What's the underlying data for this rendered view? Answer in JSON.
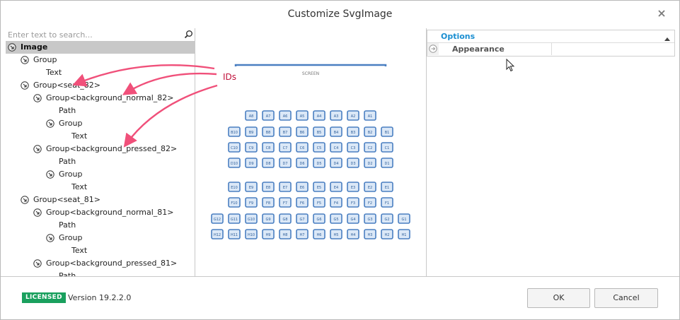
{
  "window": {
    "title": "Customize SvgImage",
    "close_icon": "close-icon"
  },
  "search": {
    "placeholder": "Enter text to search..."
  },
  "tree": {
    "nodes": [
      {
        "label": "Image",
        "level": 0,
        "icon": "collapse-arrow-icon",
        "selected": true
      },
      {
        "label": "Group",
        "level": 1,
        "icon": "collapse-arrow-icon"
      },
      {
        "label": "Text",
        "level": 2,
        "icon": ""
      },
      {
        "label": "Group<seat_82>",
        "level": 1,
        "icon": "collapse-arrow-icon"
      },
      {
        "label": "Group<background_normal_82>",
        "level": 2,
        "icon": "collapse-arrow-icon"
      },
      {
        "label": "Path",
        "level": 3,
        "icon": ""
      },
      {
        "label": "Group",
        "level": 3,
        "icon": "collapse-arrow-icon"
      },
      {
        "label": "Text",
        "level": 4,
        "icon": ""
      },
      {
        "label": "Group<background_pressed_82>",
        "level": 2,
        "icon": "collapse-arrow-icon"
      },
      {
        "label": "Path",
        "level": 3,
        "icon": ""
      },
      {
        "label": "Group",
        "level": 3,
        "icon": "collapse-arrow-icon"
      },
      {
        "label": "Text",
        "level": 4,
        "icon": ""
      },
      {
        "label": "Group<seat_81>",
        "level": 1,
        "icon": "collapse-arrow-icon"
      },
      {
        "label": "Group<background_normal_81>",
        "level": 2,
        "icon": "collapse-arrow-icon"
      },
      {
        "label": "Path",
        "level": 3,
        "icon": ""
      },
      {
        "label": "Group",
        "level": 3,
        "icon": "collapse-arrow-icon"
      },
      {
        "label": "Text",
        "level": 4,
        "icon": ""
      },
      {
        "label": "Group<background_pressed_81>",
        "level": 2,
        "icon": "collapse-arrow-icon"
      },
      {
        "label": "Path",
        "level": 3,
        "icon": ""
      }
    ]
  },
  "annotation": {
    "label": "IDs",
    "color": "#f0507a"
  },
  "preview": {
    "screen_label": "SCREEN",
    "seat_color": "#4a7fc1",
    "rows": [
      [
        "A8",
        "A7",
        "A6",
        "A5",
        "A4",
        "A3",
        "A2",
        "A1"
      ],
      [
        "B10",
        "B9",
        "B8",
        "B7",
        "B6",
        "B5",
        "B4",
        "B3",
        "B2",
        "B1"
      ],
      [
        "C10",
        "C9",
        "C8",
        "C7",
        "C6",
        "C5",
        "C4",
        "C3",
        "C2",
        "C1"
      ],
      [
        "D10",
        "D9",
        "D8",
        "D7",
        "D6",
        "D5",
        "D4",
        "D3",
        "D2",
        "D1"
      ],
      [
        "E10",
        "E9",
        "E8",
        "E7",
        "E6",
        "E5",
        "E4",
        "E3",
        "E2",
        "E1"
      ],
      [
        "F10",
        "F9",
        "F8",
        "F7",
        "F6",
        "F5",
        "F4",
        "F3",
        "F2",
        "F1"
      ],
      [
        "G12",
        "G11",
        "G10",
        "G9",
        "G8",
        "G7",
        "G6",
        "G5",
        "G4",
        "G3",
        "G2",
        "G1"
      ],
      [
        "H12",
        "H11",
        "H10",
        "H9",
        "H8",
        "H7",
        "H6",
        "H5",
        "H4",
        "H3",
        "H2",
        "H1"
      ]
    ]
  },
  "properties": {
    "category": "Options",
    "rows": [
      {
        "name": "Appearance",
        "icon": "expand-arrow-icon"
      }
    ]
  },
  "footer": {
    "badge": "LICENSED",
    "badge_color": "#1aa05e",
    "version": "Version 19.2.2.0",
    "ok_label": "OK",
    "cancel_label": "Cancel"
  }
}
